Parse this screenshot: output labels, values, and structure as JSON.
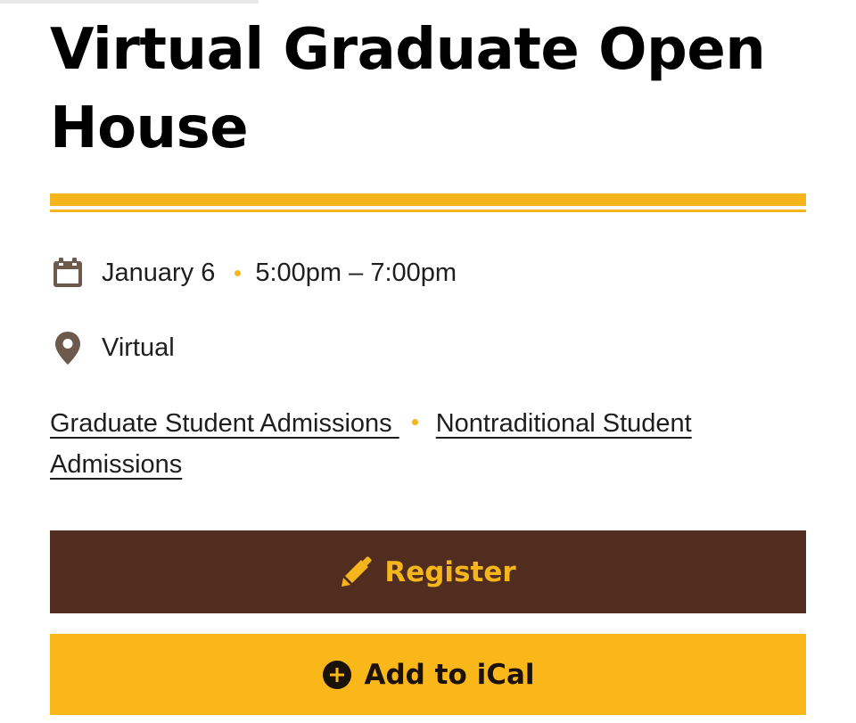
{
  "event": {
    "title": "Virtual Graduate Open House",
    "date": "January 6",
    "time": "5:00pm – 7:00pm",
    "location": "Virtual"
  },
  "categories": [
    {
      "label": "Graduate Student Admissions "
    },
    {
      "label": "Nontraditional Student Admissions"
    }
  ],
  "actions": {
    "register_label": "Register",
    "ical_label": "Add to iCal"
  },
  "icons": {
    "date": "calendar-icon",
    "location": "map-pin-icon",
    "register": "pencil-icon",
    "ical": "plus-circle-icon"
  },
  "colors": {
    "accent_gold": "#f7b51c",
    "brand_brown": "#512d20",
    "icon_brown": "#6e5a4d",
    "text_dark": "#1e1e1e"
  }
}
